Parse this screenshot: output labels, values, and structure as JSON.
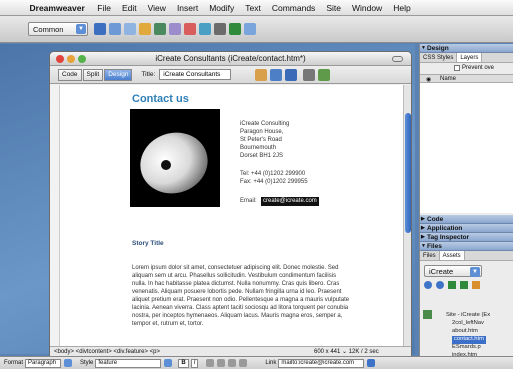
{
  "menubar": {
    "app_name": "Dreamweaver",
    "items": [
      "File",
      "Edit",
      "View",
      "Insert",
      "Modify",
      "Text",
      "Commands",
      "Site",
      "Window",
      "Help"
    ]
  },
  "insertbar": {
    "category": "Common"
  },
  "document_window": {
    "title": "iCreate Consultants (iCreate/contact.htm*)",
    "view_buttons": [
      "Code",
      "Split",
      "Design"
    ],
    "title_label": "Title:",
    "title_value": "iCreate Consultants",
    "heading": "Contact us",
    "address": [
      "iCreate Consulting",
      "Paragon House,",
      "St Peter's Road",
      "Bournemouth",
      "Dorset BH1 2JS"
    ],
    "tel": "Tel: +44 (0)1202 299900",
    "fax": "Fax: +44 (0)1202 299955",
    "email_label": "Email:",
    "email_value": "create@icreate.com",
    "story_title": "Story Title",
    "lorem_lines": [
      "Lorem ipsum dolor sit amet, consectetuer adipiscing elit. Donec molestie. Sed",
      "aliquam sem ut arcu. Phasellus sollicitudin. Vestibulum condimentum facilisis",
      "nulla. In hac habitasse platea dictumst. Nulla nonummy. Cras quis libero. Cras",
      "venenatis. Aliquam posuere lobortis pede. Nullam fringilla urna id leo. Praesent",
      "aliquet pretium erat. Praesent non odio. Pellentesque a magna a mauris vulputate",
      "lacinia. Aenean viverra. Class aptent taciti sociosqu ad litora torquent per conubia",
      "nostra, per inceptos hymenaeos. Aliquam lacus. Mauris magna eros, semper a,",
      "tempor et, rutrum et, tortor."
    ],
    "tag_selector": "<body> <divtcontent> <div.feature> <p>",
    "size_readout": "600 x 441 ⌄ 12K / 2 sec"
  },
  "right_panel": {
    "design_header": "Design",
    "tabs": [
      "CSS Styles",
      "Layers"
    ],
    "prevent_overlaps": "Prevent ove",
    "name_col": "Name",
    "collapsed": [
      "Code",
      "Application",
      "Tag Inspector"
    ],
    "files_header": "Files",
    "files_tabs": [
      "Files",
      "Assets"
    ],
    "site": "iCreate",
    "tree": [
      "Site - iCreate (Ex",
      "2col_leftNav",
      "about.htm",
      "contact.htm",
      "ESmards.p",
      "index.htm"
    ]
  },
  "propbar": {
    "format_label": "Format",
    "format_value": "Paragraph",
    "style_label": "Style",
    "style_value": "feature",
    "link_label": "Link",
    "link_value": "mailto:icreate@icreate.com"
  }
}
